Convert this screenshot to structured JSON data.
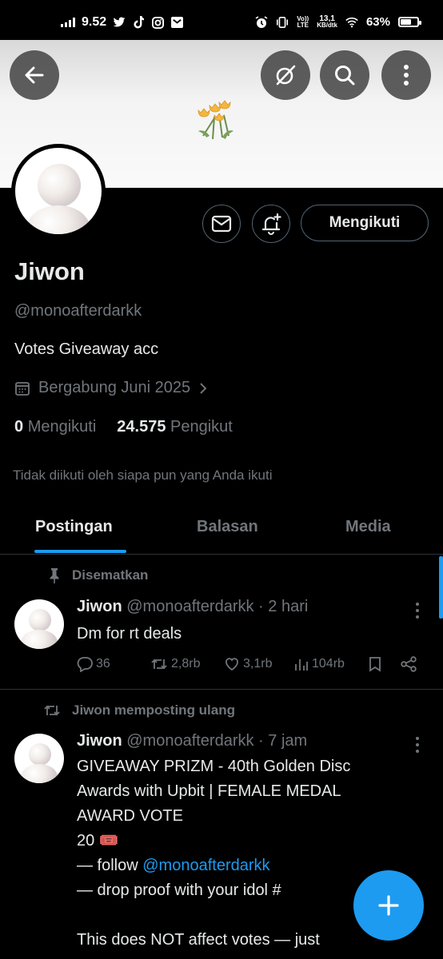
{
  "status_bar": {
    "time": "9.52",
    "network_speed_value": "13,1",
    "network_speed_unit": "KB/dtk",
    "lte_top": "Vo))",
    "lte_bottom": "LTE",
    "battery": "63%"
  },
  "profile": {
    "name": "Jiwon",
    "handle": "@monoafterdarkk",
    "bio": "Votes Giveaway acc",
    "joined": "Bergabung Juni 2025",
    "following_count": "0",
    "following_label": "Mengikuti",
    "followers_count": "24.575",
    "followers_label": "Pengikut",
    "not_followed_note": "Tidak diikuti oleh siapa pun yang Anda ikuti",
    "follow_button": "Mengikuti"
  },
  "tabs": [
    {
      "label": "Postingan",
      "active": true
    },
    {
      "label": "Balasan",
      "active": false
    },
    {
      "label": "Media",
      "active": false
    }
  ],
  "posts": [
    {
      "context": "Disematkan",
      "context_icon": "pin-icon",
      "name": "Jiwon",
      "handle_time": "@monoafterdarkk · 2 hari",
      "text": "Dm for rt deals",
      "replies": "36",
      "reposts": "2,8rb",
      "likes": "3,1rb",
      "views": "104rb"
    },
    {
      "context": "Jiwon memposting ulang",
      "context_icon": "repost-icon",
      "name": "Jiwon",
      "handle_time": "@monoafterdarkk · 7 jam",
      "line1": "GIVEAWAY PRIZM - 40th Golden Disc",
      "line2": "Awards with Upbit | FEMALE MEDAL",
      "line3": "AWARD VOTE",
      "line4": "20 🎟️",
      "line5_prefix": "— follow ",
      "line5_mention": "@monoafterdarkk",
      "line6": "— drop proof with your idol #",
      "line8": "This does NOT affect votes — just"
    }
  ],
  "colors": {
    "accent": "#1d9bf0",
    "background": "#000000",
    "muted": "#71767b",
    "divider": "#2f3336"
  }
}
